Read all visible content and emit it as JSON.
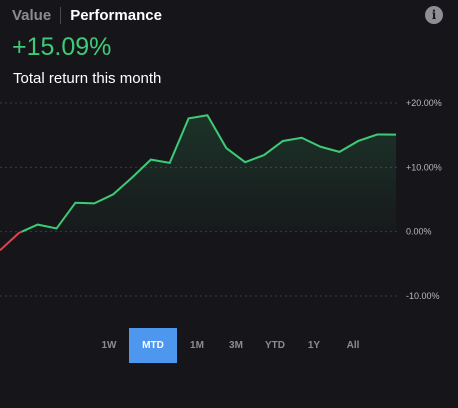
{
  "header": {
    "tabs": [
      {
        "label": "Value",
        "active": false
      },
      {
        "label": "Performance",
        "active": true
      }
    ],
    "info_icon": "info-icon"
  },
  "summary": {
    "return_value": "+15.09%",
    "return_label": "Total return this month"
  },
  "chart_data": {
    "type": "line",
    "title": "",
    "xlabel": "",
    "ylabel": "",
    "y_tick_labels": [
      "+20.00%",
      "+10.00%",
      "0.00%",
      "-10.00%"
    ],
    "y_ticks": [
      20,
      10,
      0,
      -10
    ],
    "ylim": [
      -10,
      20
    ],
    "grid": true,
    "series": [
      {
        "values": [
          -2.9,
          -0.2,
          1.1,
          0.5,
          4.5,
          4.4,
          5.8,
          8.4,
          11.2,
          10.7,
          17.6,
          18.1,
          13.0,
          10.8,
          11.9,
          14.1,
          14.6,
          13.2,
          12.4,
          14.1,
          15.1,
          15.09
        ],
        "line_color": "#3ecb76",
        "negative_color": "#e6404f"
      }
    ]
  },
  "range_selector": {
    "options": [
      "1W",
      "MTD",
      "1M",
      "3M",
      "YTD",
      "1Y",
      "All"
    ],
    "selected": "MTD"
  },
  "colors": {
    "background": "#16161a",
    "positive": "#3ecb76",
    "negative": "#e6404f",
    "accent": "#4d97ee",
    "muted": "#8b8b92"
  }
}
